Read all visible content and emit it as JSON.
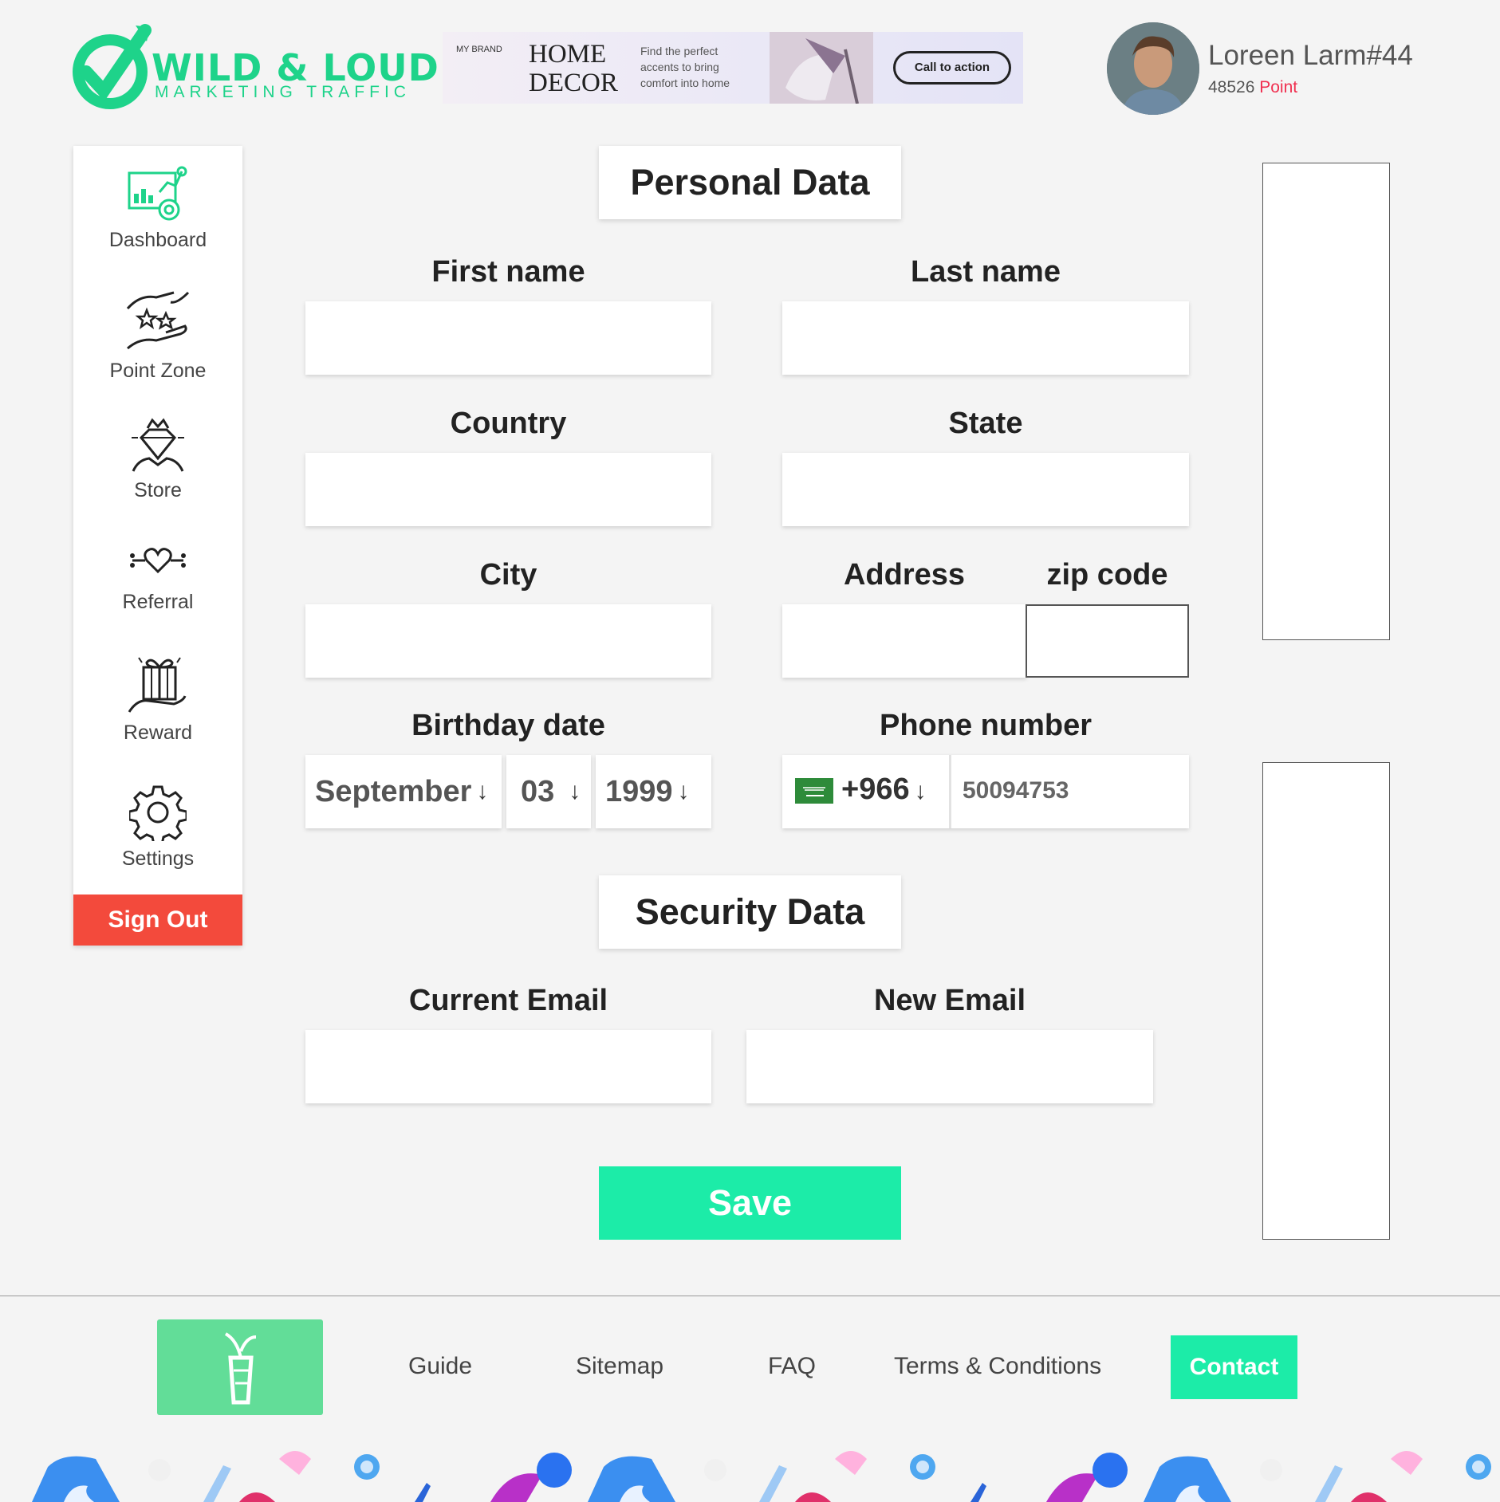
{
  "header": {
    "logo": {
      "name": "WILD & LOUD",
      "tagline": "MARKETING TRAFFIC"
    },
    "banner": {
      "brand": "MY BRAND",
      "title_line1": "HOME",
      "title_line2": "DECOR",
      "tagline": "Find the perfect accents to bring comfort into home",
      "cta": "Call to action"
    },
    "user": {
      "name": "Loreen Larm#44",
      "points": "48526",
      "points_label": "Point"
    }
  },
  "sidebar": {
    "items": [
      {
        "label": "Dashboard",
        "icon": "dashboard-chart-icon"
      },
      {
        "label": "Point Zone",
        "icon": "hands-stars-icon"
      },
      {
        "label": "Store",
        "icon": "diamond-crown-icon"
      },
      {
        "label": "Referral",
        "icon": "heart-network-icon"
      },
      {
        "label": "Reward",
        "icon": "gift-hand-icon"
      },
      {
        "label": "Settings",
        "icon": "gear-icon"
      }
    ],
    "sign_out": "Sign Out"
  },
  "form": {
    "personal_title": "Personal Data",
    "first_name": {
      "label": "First name",
      "value": ""
    },
    "last_name": {
      "label": "Last name",
      "value": ""
    },
    "country": {
      "label": "Country",
      "value": ""
    },
    "state": {
      "label": "State",
      "value": ""
    },
    "city": {
      "label": "City",
      "value": ""
    },
    "address": {
      "label": "Address",
      "value": ""
    },
    "zip": {
      "label": "zip code",
      "value": ""
    },
    "birthday": {
      "label": "Birthday date",
      "month": "September",
      "day": "03",
      "year": "1999"
    },
    "phone": {
      "label": "Phone number",
      "dial_code": "+966",
      "number": "50094753",
      "flag": "saudi-arabia-flag"
    },
    "security_title": "Security Data",
    "current_email": {
      "label": "Current Email",
      "value": ""
    },
    "new_email": {
      "label": "New Email",
      "value": ""
    },
    "save": "Save"
  },
  "footer": {
    "links": [
      "Guide",
      "Sitemap",
      "FAQ",
      "Terms & Conditions"
    ],
    "contact": "Contact"
  },
  "colors": {
    "accent": "#1ceca8",
    "logo_green": "#1ed38a",
    "sign_out": "#f34a3c",
    "points_red": "#f03050"
  }
}
